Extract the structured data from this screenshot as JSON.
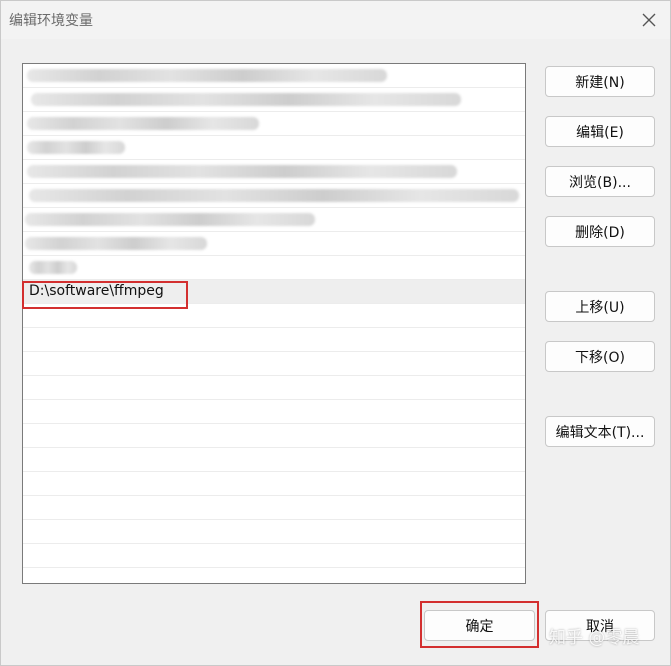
{
  "window": {
    "title": "编辑环境变量",
    "close_icon": "close-icon"
  },
  "list": {
    "visible_path": "D:\\software\\ffmpeg"
  },
  "buttons": {
    "new": "新建(N)",
    "edit": "编辑(E)",
    "browse": "浏览(B)...",
    "delete": "删除(D)",
    "move_up": "上移(U)",
    "move_down": "下移(O)",
    "edit_text": "编辑文本(T)...",
    "ok": "确定",
    "cancel": "取消"
  },
  "watermark": {
    "text": "知乎 @零晨"
  },
  "colors": {
    "highlight_border": "#d32f2f",
    "background": "#f0f0f0"
  }
}
